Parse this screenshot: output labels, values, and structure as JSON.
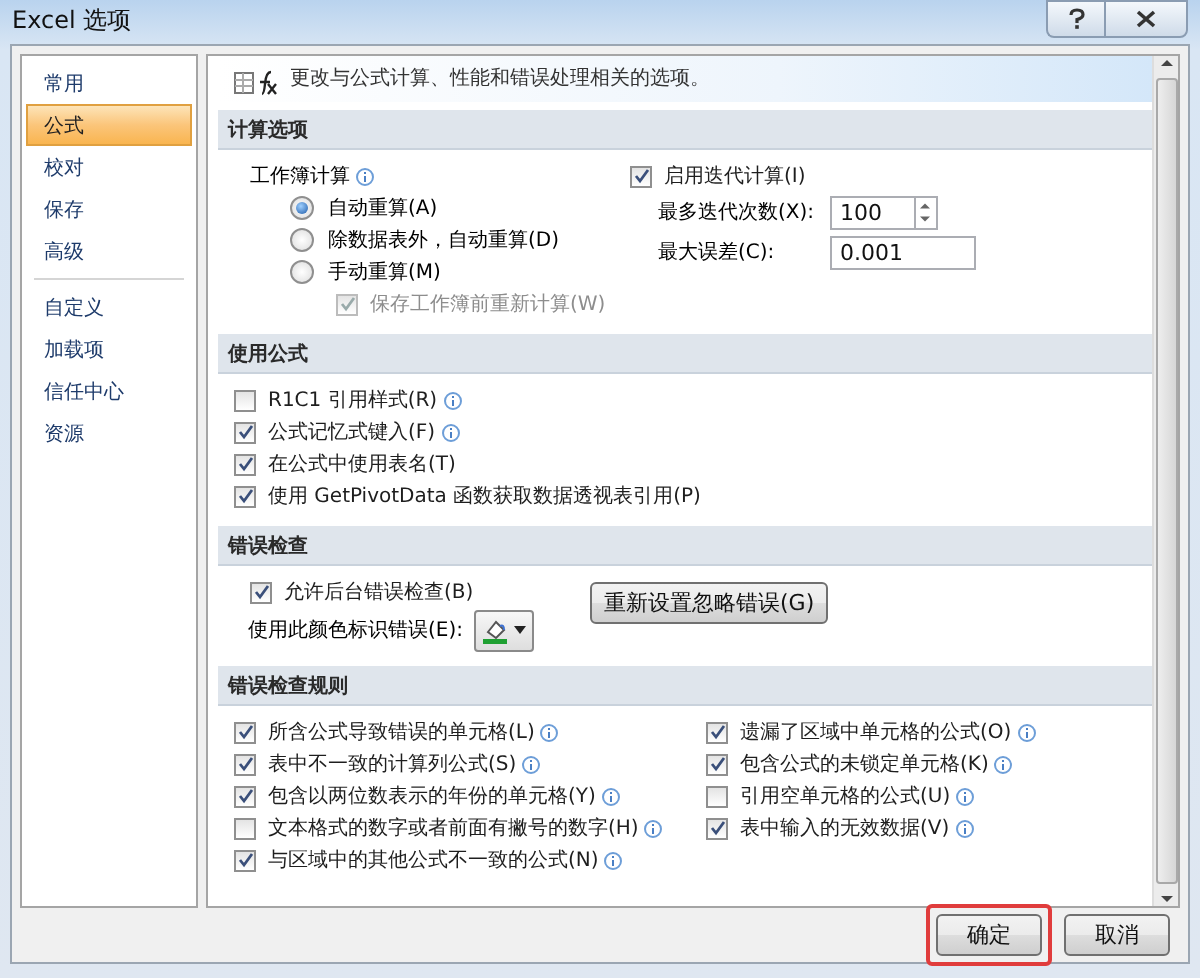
{
  "window": {
    "title": "Excel 选项"
  },
  "sidebar": {
    "groups": [
      [
        {
          "label": "常用",
          "selected": false
        },
        {
          "label": "公式",
          "selected": true
        },
        {
          "label": "校对",
          "selected": false
        },
        {
          "label": "保存",
          "selected": false
        },
        {
          "label": "高级",
          "selected": false
        }
      ],
      [
        {
          "label": "自定义",
          "selected": false
        },
        {
          "label": "加载项",
          "selected": false
        },
        {
          "label": "信任中心",
          "selected": false
        },
        {
          "label": "资源",
          "selected": false
        }
      ]
    ]
  },
  "header": {
    "text": "更改与公式计算、性能和错误处理相关的选项。"
  },
  "sections": [
    {
      "kind": "calculation",
      "title": "计算选项",
      "group_label": "工作簿计算",
      "group_info": true,
      "options": [
        {
          "label": "自动重算(A)",
          "selected": true
        },
        {
          "label": "除数据表外，自动重算(D)",
          "selected": false
        },
        {
          "label": "手动重算(M)",
          "selected": false
        }
      ],
      "sub_option": {
        "label": "保存工作簿前重新计算(W)",
        "checked": true,
        "disabled": true
      },
      "iteration": {
        "label": "启用迭代计算(I)",
        "checked": true
      },
      "max_iterations": {
        "label": "最多迭代次数(X):",
        "value": "100"
      },
      "max_change": {
        "label": "最大误差(C):",
        "value": "0.001"
      }
    },
    {
      "kind": "checklist",
      "title": "使用公式",
      "items": [
        {
          "label": "R1C1 引用样式(R)",
          "checked": false,
          "info": true
        },
        {
          "label": "公式记忆式键入(F)",
          "checked": true,
          "info": true
        },
        {
          "label": "在公式中使用表名(T)",
          "checked": true,
          "info": false
        },
        {
          "label": "使用 GetPivotData 函数获取数据透视表引用(P)",
          "checked": true,
          "info": false
        }
      ]
    },
    {
      "kind": "error_checking",
      "title": "错误检查",
      "enable": {
        "label": "允许后台错误检查(B)",
        "checked": true
      },
      "color_label": "使用此颜色标识错误(E):",
      "reset_button": "重新设置忽略错误(G)"
    },
    {
      "kind": "rules",
      "title": "错误检查规则",
      "columns": [
        [
          {
            "label": "所含公式导致错误的单元格(L)",
            "checked": true,
            "info": true
          },
          {
            "label": "表中不一致的计算列公式(S)",
            "checked": true,
            "info": true
          },
          {
            "label": "包含以两位数表示的年份的单元格(Y)",
            "checked": true,
            "info": true
          },
          {
            "label": "文本格式的数字或者前面有撇号的数字(H)",
            "checked": false,
            "info": true
          },
          {
            "label": "与区域中的其他公式不一致的公式(N)",
            "checked": true,
            "info": true
          }
        ],
        [
          {
            "label": "遗漏了区域中单元格的公式(O)",
            "checked": true,
            "info": true
          },
          {
            "label": "包含公式的未锁定单元格(K)",
            "checked": true,
            "info": true
          },
          {
            "label": "引用空单元格的公式(U)",
            "checked": false,
            "info": true
          },
          {
            "label": "表中输入的无效数据(V)",
            "checked": true,
            "info": true
          }
        ]
      ]
    }
  ],
  "buttons": [
    {
      "label": "确定",
      "highlighted": true
    },
    {
      "label": "取消",
      "highlighted": false
    }
  ]
}
